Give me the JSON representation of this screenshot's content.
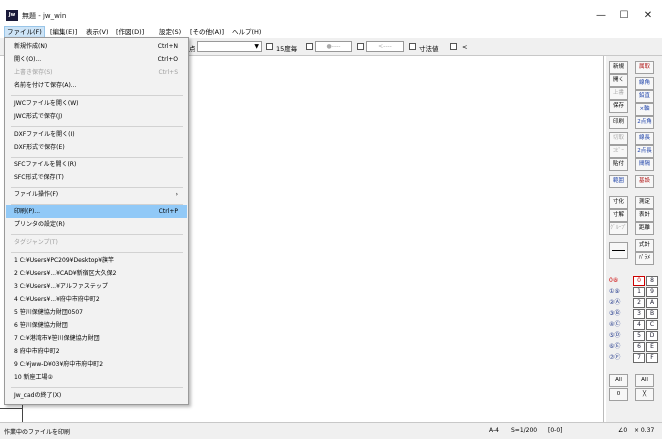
{
  "window": {
    "title": "無題 - jw_win",
    "icon_text": "Jw",
    "minimize": "—",
    "maximize": "☐",
    "close": "✕"
  },
  "menubar": [
    "ファイル(F)",
    "[編集(E)]",
    "表示(V)",
    "[作図(D)]",
    "設定(S)",
    "[その他(A)]",
    "ヘルプ(H)"
  ],
  "toolbar": {
    "partial_label": "点",
    "checkbox_15": "15度毎",
    "dim_label": "寸法値",
    "last_label": "<",
    "ghost_box1": "●----",
    "ghost_box2": "<----"
  },
  "file_menu": [
    {
      "label": "新規作成(N)",
      "shortcut": "Ctrl+N",
      "disabled": false
    },
    {
      "label": "開く(O)...",
      "shortcut": "Ctrl+O",
      "disabled": false
    },
    {
      "label": "上書き保存(S)",
      "shortcut": "Ctrl+S",
      "disabled": true
    },
    {
      "label": "名前を付けて保存(A)...",
      "shortcut": "",
      "disabled": false
    },
    {
      "label": "JWCファイルを開く(W)",
      "shortcut": "",
      "disabled": false
    },
    {
      "label": "JWC形式で保存(J)",
      "shortcut": "",
      "disabled": false
    },
    {
      "label": "DXFファイルを開く(I)",
      "shortcut": "",
      "disabled": false
    },
    {
      "label": "DXF形式で保存(E)",
      "shortcut": "",
      "disabled": false
    },
    {
      "label": "SFCファイルを開く(R)",
      "shortcut": "",
      "disabled": false
    },
    {
      "label": "SFC形式で保存(T)",
      "shortcut": "",
      "disabled": false
    },
    {
      "label": "ファイル操作(F)",
      "shortcut": "›",
      "disabled": false
    },
    {
      "label": "印刷(P)...",
      "shortcut": "Ctrl+P",
      "disabled": false,
      "highlighted": true
    },
    {
      "label": "プリンタの設定(R)",
      "shortcut": "",
      "disabled": false
    },
    {
      "label": "タグジャンプ(T)",
      "shortcut": "",
      "disabled": true
    },
    {
      "label": "1 C:¥Users¥PC209¥Desktop¥旗竿",
      "shortcut": "",
      "disabled": false
    },
    {
      "label": "2 C:¥Users¥...¥CAD¥新宿区大久保2",
      "shortcut": "",
      "disabled": false
    },
    {
      "label": "3 C:¥Users¥...¥アルファステップ",
      "shortcut": "",
      "disabled": false
    },
    {
      "label": "4 C:¥Users¥...¥府中市府中町2",
      "shortcut": "",
      "disabled": false
    },
    {
      "label": "5 笹川保健協力財団0507",
      "shortcut": "",
      "disabled": false
    },
    {
      "label": "6 笹川保健協力財団",
      "shortcut": "",
      "disabled": false
    },
    {
      "label": "7 C:¥港湾市¥笹川保健協力財団",
      "shortcut": "",
      "disabled": false
    },
    {
      "label": "8 府中市府中町2",
      "shortcut": "",
      "disabled": false
    },
    {
      "label": "9 C:¥jww-D¥03¥府中市府中町2",
      "shortcut": "",
      "disabled": false
    },
    {
      "label": "10 新座工場②",
      "shortcut": "",
      "disabled": false
    },
    {
      "label": "Jw_cadの終了(X)",
      "shortcut": "",
      "disabled": false
    }
  ],
  "right_panel": {
    "left_col": [
      {
        "label": "新規",
        "disabled": false,
        "color": "normal"
      },
      {
        "label": "開く",
        "disabled": false,
        "color": "normal"
      },
      {
        "label": "上書",
        "disabled": true,
        "color": "normal"
      },
      {
        "label": "保存",
        "disabled": false,
        "color": "normal"
      },
      {
        "label": "印刷",
        "disabled": false,
        "color": "normal"
      },
      {
        "label": "切取",
        "disabled": true,
        "color": "normal"
      },
      {
        "label": "ｺﾋﾟｰ",
        "disabled": true,
        "color": "normal"
      },
      {
        "label": "貼付",
        "disabled": false,
        "color": "normal"
      },
      {
        "label": "範囲",
        "disabled": false,
        "color": "blue"
      },
      {
        "label": "寸化",
        "disabled": false,
        "color": "normal"
      },
      {
        "label": "寸解",
        "disabled": false,
        "color": "normal"
      },
      {
        "label": "ｸﾞﾙｰﾌﾟ",
        "disabled": true,
        "color": "normal"
      }
    ],
    "right_col": [
      {
        "label": "属取",
        "color": "red"
      },
      {
        "label": "線角",
        "color": "blue"
      },
      {
        "label": "鉛直",
        "color": "blue"
      },
      {
        "label": "×軸",
        "color": "blue"
      },
      {
        "label": "2点角",
        "color": "blue"
      },
      {
        "label": "線長",
        "color": "blue"
      },
      {
        "label": "2点長",
        "color": "blue"
      },
      {
        "label": "間隔",
        "color": "blue"
      },
      {
        "label": "基設",
        "color": "red"
      },
      {
        "label": "測定",
        "color": "normal"
      },
      {
        "label": "表計",
        "color": "normal"
      },
      {
        "label": "距離",
        "color": "normal"
      },
      {
        "label": "式計",
        "color": "normal"
      },
      {
        "label": "ﾊﾟﾗﾒ",
        "color": "normal"
      }
    ],
    "layer_left": [
      "0⑧",
      "①⑨",
      "②Ⓐ",
      "③Ⓑ",
      "④Ⓒ",
      "⑤Ⓓ",
      "⑥Ⓔ",
      "⑦Ⓕ"
    ],
    "layer_right": [
      [
        "0",
        "8"
      ],
      [
        "1",
        "9"
      ],
      [
        "2",
        "A"
      ],
      [
        "3",
        "B"
      ],
      [
        "4",
        "C"
      ],
      [
        "5",
        "D"
      ],
      [
        "6",
        "E"
      ],
      [
        "7",
        "F"
      ]
    ],
    "all_left": "All",
    "zero_left": "0",
    "all_right": "All",
    "x_right": "╳"
  },
  "status": {
    "message": "作業中のファイルを印刷",
    "paper": "A-4",
    "scale": "S=1/200",
    "layer": "[0-0]",
    "angle": "∠0",
    "zoom": "× 0.37"
  }
}
